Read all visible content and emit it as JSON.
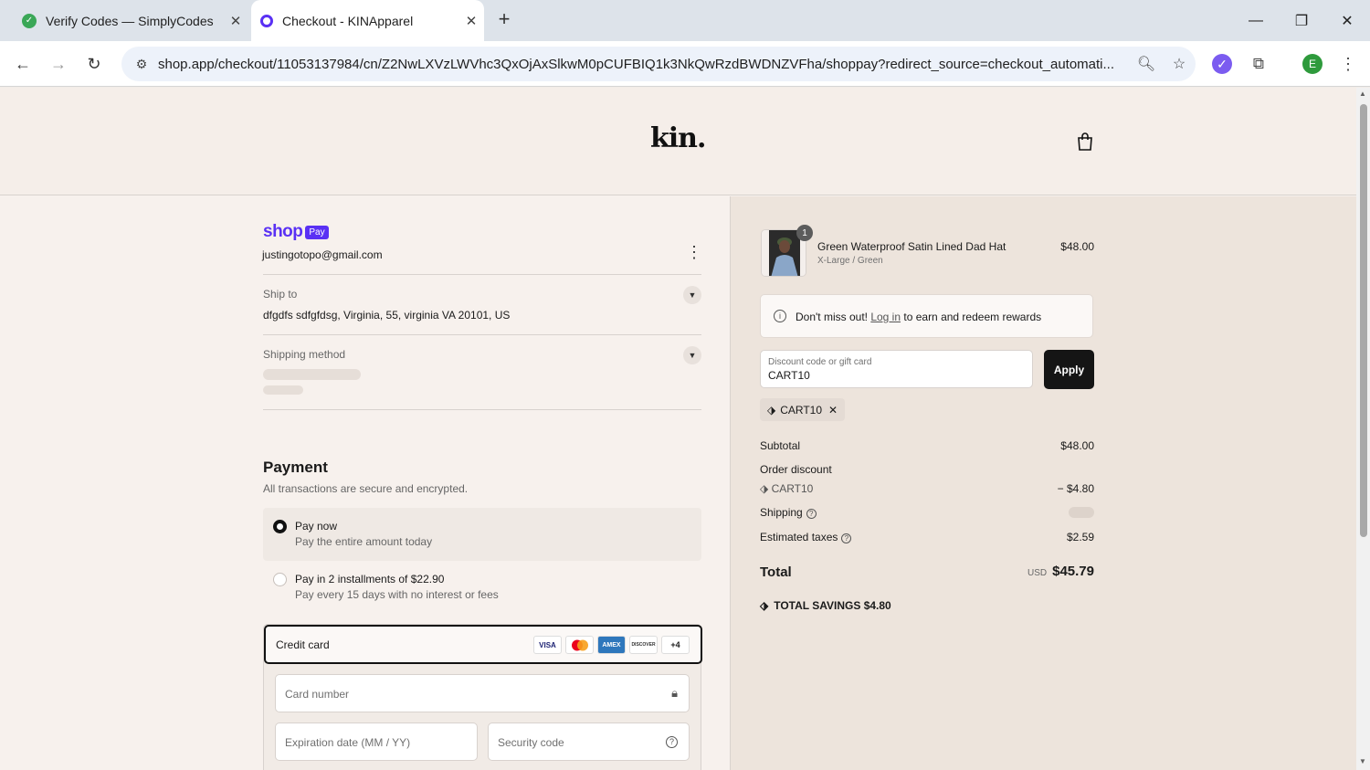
{
  "browser": {
    "tabs": [
      {
        "title": "Verify Codes — SimplyCodes"
      },
      {
        "title": "Checkout - KINApparel"
      }
    ],
    "url": "shop.app/checkout/11053137984/cn/Z2NwLXVzLWVhc3QxOjAxSlkwM0pCUFBIQ1k3NkQwRzdBWDNZVFha/shoppay?redirect_source=checkout_automati...",
    "profile_initial": "E"
  },
  "header": {
    "logo": "kin."
  },
  "account": {
    "brand": "shop",
    "brand_badge": "Pay",
    "email": "justingotopo@gmail.com"
  },
  "ship_to": {
    "label": "Ship to",
    "value": "dfgdfs sdfgfdsg, Virginia, 55, virginia VA 20101, US"
  },
  "shipping_method": {
    "label": "Shipping method"
  },
  "payment": {
    "title": "Payment",
    "subtitle": "All transactions are secure and encrypted.",
    "options": [
      {
        "title": "Pay now",
        "subtitle": "Pay the entire amount today"
      },
      {
        "title": "Pay in 2 installments of $22.90",
        "subtitle": "Pay every 15 days with no interest or fees"
      }
    ],
    "credit_card_label": "Credit card",
    "card_brands": [
      "VISA",
      "MC",
      "AMEX",
      "DISCOVER"
    ],
    "more_brands": "+4",
    "card_number_placeholder": "Card number",
    "expiration_placeholder": "Expiration date (MM / YY)",
    "security_placeholder": "Security code"
  },
  "order": {
    "item": {
      "quantity": "1",
      "name": "Green Waterproof Satin Lined Dad Hat",
      "variant": "X-Large / Green",
      "price": "$48.00"
    },
    "notice": {
      "prefix": "Don't miss out!",
      "link": "Log in",
      "suffix": "to earn and redeem rewards"
    },
    "discount": {
      "label": "Discount code or gift card",
      "value": "CART10",
      "apply_label": "Apply",
      "chip": "CART10"
    },
    "summary": {
      "subtotal_label": "Subtotal",
      "subtotal": "$48.00",
      "order_discount_label": "Order discount",
      "discount_code": "CART10",
      "discount_amount": "− $4.80",
      "shipping_label": "Shipping",
      "taxes_label": "Estimated taxes",
      "taxes": "$2.59",
      "total_label": "Total",
      "currency": "USD",
      "total": "$45.79",
      "savings_label": "TOTAL SAVINGS",
      "savings": "$4.80"
    }
  },
  "colors": {
    "shop_purple": "#5a31f4",
    "apply_button": "#151515",
    "page_bg": "#f7f1ed",
    "summary_bg": "#ede4dc"
  }
}
